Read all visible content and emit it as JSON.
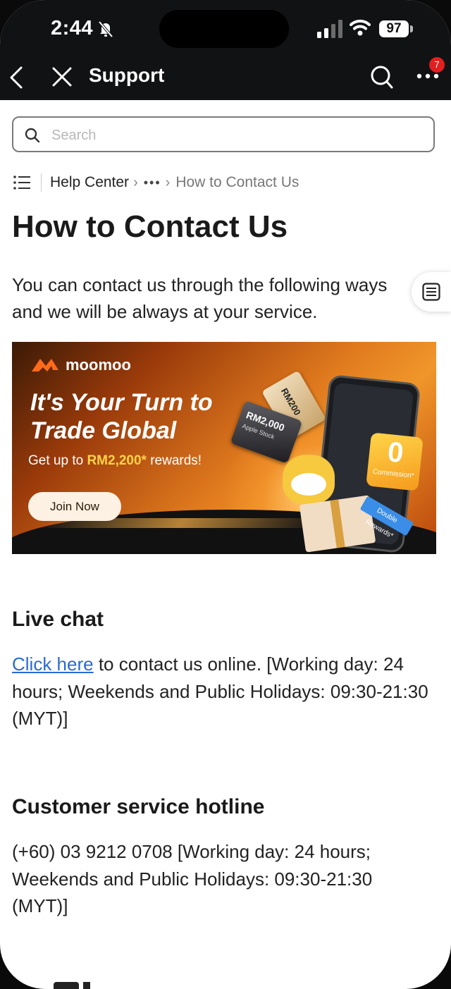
{
  "status_bar": {
    "time": "2:44",
    "battery": "97"
  },
  "nav": {
    "title": "Support",
    "badge_count": "7"
  },
  "search": {
    "placeholder": "Search"
  },
  "breadcrumb": {
    "root": "Help Center",
    "ellipsis": "•••",
    "current": "How to Contact Us"
  },
  "article": {
    "title": "How to Contact Us",
    "intro": "You can contact us through the following ways and we will be always at your service."
  },
  "banner": {
    "brand": "moomoo",
    "headline_line1": "It's Your Turn to",
    "headline_line2": "Trade Global",
    "sub_prefix": "Get up to ",
    "sub_highlight": "RM2,200*",
    "sub_suffix": " rewards!",
    "button": "Join Now",
    "card_small": "RM200",
    "card_large": "RM2,000",
    "card_large_sub": "Apple Stock",
    "zero_value": "0",
    "zero_label": "Commission*",
    "tag": "Double Rewards*",
    "colors": {
      "accent": "#f0962a",
      "highlight": "#ffd24a"
    }
  },
  "sections": [
    {
      "heading": "Live chat",
      "link_text": "Click here",
      "text": " to contact us online. [Working day: 24 hours; Weekends and Public Holidays: 09:30-21:30 (MYT)]"
    },
    {
      "heading": "Customer service hotline",
      "text": "(+60) 03 9212 0708 [Working day: 24 hours; Weekends and Public Holidays: 09:30-21:30 (MYT)]"
    }
  ],
  "icons": [
    "bell-muted-icon",
    "signal-icon",
    "wifi-icon",
    "battery-icon",
    "back-arrow-icon",
    "close-icon",
    "search-icon",
    "more-icon",
    "list-icon",
    "toc-icon",
    "moomoo-logo-icon"
  ]
}
